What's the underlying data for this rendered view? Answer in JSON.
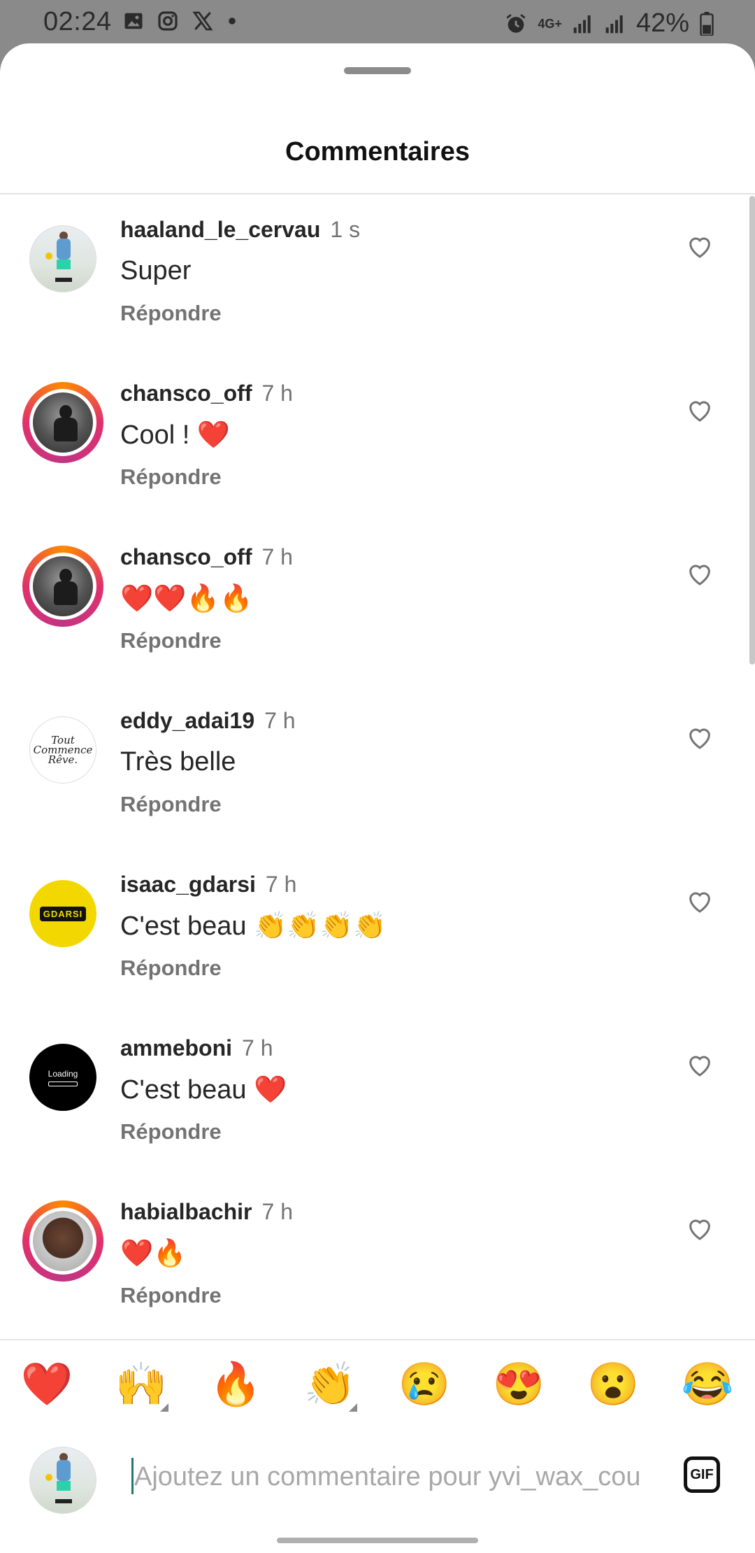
{
  "status_bar": {
    "time": "02:24",
    "left_icons": [
      "image-icon",
      "instagram-icon",
      "x-icon",
      "dot-icon"
    ],
    "right_icons": [
      "alarm-icon",
      "network-4g-icon",
      "signal-icon",
      "signal-icon"
    ],
    "network": "4G+",
    "battery": "42%"
  },
  "sheet": {
    "title": "Commentaires"
  },
  "comments": [
    {
      "username": "haaland_le_cervau",
      "time": "1 s",
      "text": "Super",
      "reply": "Répondre",
      "avatar": "photo-player",
      "story_ring": false
    },
    {
      "username": "chansco_off",
      "time": "7 h",
      "text": "Cool ! ❤️",
      "reply": "Répondre",
      "avatar": "photo-dark",
      "story_ring": true
    },
    {
      "username": "chansco_off",
      "time": "7 h",
      "text": "❤️❤️🔥🔥",
      "reply": "Répondre",
      "avatar": "photo-dark",
      "story_ring": true
    },
    {
      "username": "eddy_adai19",
      "time": "7 h",
      "text": "Très belle",
      "reply": "Répondre",
      "avatar": "script-logo",
      "story_ring": false,
      "avatar_text": "Tout Commence Rêve."
    },
    {
      "username": "isaac_gdarsi",
      "time": "7 h",
      "text": "C'est beau 👏👏👏👏",
      "reply": "Répondre",
      "avatar": "yellow-logo",
      "story_ring": false,
      "avatar_text": "GDARSI"
    },
    {
      "username": "ammeboni",
      "time": "7 h",
      "text": "C'est beau ❤️",
      "reply": "Répondre",
      "avatar": "loading-logo",
      "story_ring": false,
      "avatar_text": "Loading"
    },
    {
      "username": "habialbachir",
      "time": "7 h",
      "text": "❤️🔥",
      "reply": "Répondre",
      "avatar": "photo-selfie",
      "story_ring": true
    }
  ],
  "emoji_bar": [
    "❤️",
    "🙌",
    "🔥",
    "👏",
    "😢",
    "😍",
    "😮",
    "😂"
  ],
  "input": {
    "placeholder": "Ajoutez un commentaire pour yvi_wax_cou",
    "gif_label": "GIF"
  },
  "colors": {
    "story_ring_start": "#ff8a00",
    "story_ring_end": "#c13584",
    "caret": "#1d7b6e",
    "secondary_text": "#737373"
  }
}
